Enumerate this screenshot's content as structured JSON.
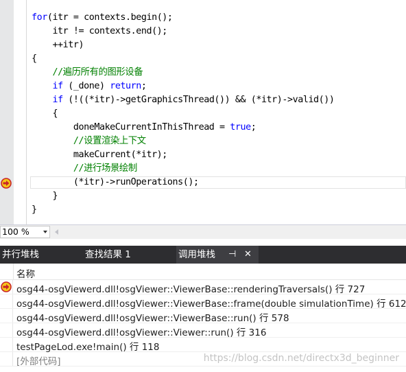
{
  "editor": {
    "lines": [
      [
        {
          "t": "for",
          "c": "kw"
        },
        {
          "t": "(itr = contexts.begin();"
        }
      ],
      [
        {
          "t": "    itr != contexts.end();"
        }
      ],
      [
        {
          "t": "    ++itr)"
        }
      ],
      [
        {
          "t": "{"
        }
      ],
      [
        {
          "t": "    "
        },
        {
          "t": "//遍历所有的图形设备",
          "c": "cm"
        }
      ],
      [
        {
          "t": "    "
        },
        {
          "t": "if",
          "c": "kw"
        },
        {
          "t": " (_done) "
        },
        {
          "t": "return",
          "c": "kw"
        },
        {
          "t": ";"
        }
      ],
      [
        {
          "t": "    "
        },
        {
          "t": "if",
          "c": "kw"
        },
        {
          "t": " (!((*itr)->getGraphicsThread()) && (*itr)->valid())"
        }
      ],
      [
        {
          "t": "    {"
        }
      ],
      [
        {
          "t": "        doneMakeCurrentInThisThread = "
        },
        {
          "t": "true",
          "c": "kw"
        },
        {
          "t": ";"
        }
      ],
      [
        {
          "t": "        "
        },
        {
          "t": "//设置渲染上下文",
          "c": "cm"
        }
      ],
      [
        {
          "t": "        makeCurrent(*itr);"
        }
      ],
      [
        {
          "t": "        "
        },
        {
          "t": "//进行场景绘制",
          "c": "cm"
        }
      ],
      [
        {
          "t": "        (*itr)->runOperations();"
        }
      ],
      [
        {
          "t": "    }"
        }
      ],
      [
        {
          "t": "}"
        }
      ]
    ],
    "gutter_marker": "current-statement-arrow-icon"
  },
  "zoom": {
    "value": "100 %"
  },
  "tabs": {
    "items": [
      {
        "label": "并行堆栈",
        "active": false
      },
      {
        "label": "查找结果 1",
        "active": false
      },
      {
        "label": "调用堆栈",
        "active": true
      }
    ],
    "pin_glyph": "⊣",
    "close_glyph": "✕"
  },
  "callstack": {
    "column_name": "名称",
    "rows": [
      {
        "text": "osg44-osgViewerd.dll!osgViewer::ViewerBase::renderingTraversals() 行 727",
        "current": true
      },
      {
        "text": "osg44-osgViewerd.dll!osgViewer::ViewerBase::frame(double simulationTime) 行 612",
        "current": false
      },
      {
        "text": "osg44-osgViewerd.dll!osgViewer::ViewerBase::run() 行 578",
        "current": false
      },
      {
        "text": "osg44-osgViewerd.dll!osgViewer::Viewer::run() 行 316",
        "current": false
      },
      {
        "text": "testPageLod.exe!main() 行 118",
        "current": false
      },
      {
        "text": "[外部代码]",
        "current": false,
        "external": true
      }
    ],
    "watermark": "https://blog.csdn.net/directx3d_beginner"
  },
  "colors": {
    "keyword": "#0000ff",
    "comment": "#008000",
    "tab_strip": "#2d2d30",
    "arrow_fill": "#f5c518",
    "arrow_ring": "#c8242a"
  }
}
